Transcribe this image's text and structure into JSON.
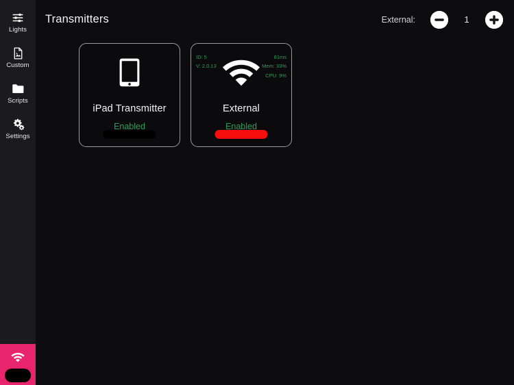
{
  "colors": {
    "app_background": "#0d0d0f",
    "sidebar_background": "#1b1b1f",
    "accent_pink": "#e8246d",
    "status_green": "#2f9e59",
    "bar_red": "#f70d0d",
    "bar_black": "#000000",
    "card_border": "#9b9b9e"
  },
  "sidebar": {
    "items": [
      {
        "label": "Lights",
        "icon": "sliders-icon"
      },
      {
        "label": "Custom",
        "icon": "image-file-icon"
      },
      {
        "label": "Scripts",
        "icon": "folder-icon"
      },
      {
        "label": "Settings",
        "icon": "gears-icon"
      }
    ],
    "active_tile": {
      "icon": "wifi-icon",
      "label": ""
    }
  },
  "header": {
    "title": "Transmitters",
    "stepper": {
      "label": "External:",
      "value": "1",
      "decrement_icon": "minus-circle-icon",
      "increment_icon": "plus-circle-icon"
    }
  },
  "cards": [
    {
      "name": "ipad-transmitter",
      "icon": "tablet-icon",
      "title": "iPad Transmitter",
      "status": "Enabled",
      "bar_style": "bar-black",
      "stats": null
    },
    {
      "name": "external-transmitter",
      "icon": "wifi-icon",
      "title": "External",
      "status": "Enabled",
      "bar_style": "bar-red",
      "stats": {
        "id": "ID: 5",
        "version": "V: 2.0.13",
        "latency": "81ms",
        "memory": "Mem: 33%",
        "cpu": "CPU: 9%"
      }
    }
  ]
}
